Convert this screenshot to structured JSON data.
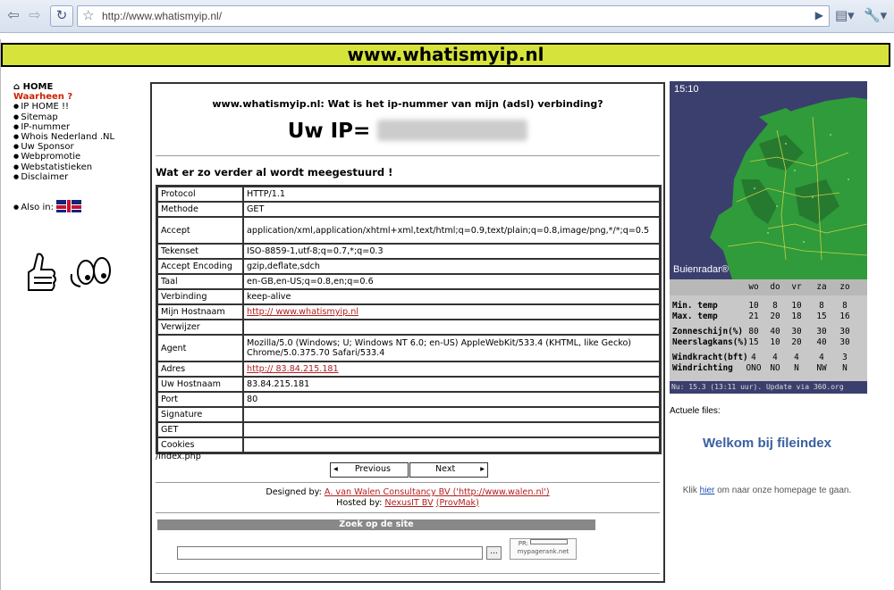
{
  "browser": {
    "url": "http://www.whatismyip.nl/"
  },
  "site": {
    "title": "www.whatismyip.nl"
  },
  "nav": {
    "home": "HOME",
    "where": "Waarheen ?",
    "items": [
      "IP HOME !!",
      "Sitemap",
      "IP-nummer",
      "Whois Nederland .NL",
      "Uw Sponsor",
      "Webpromotie",
      "Webstatistieken",
      "Disclaimer"
    ],
    "also_in": "Also in:"
  },
  "main": {
    "question": "www.whatismyip.nl: Wat is het ip-nummer van mijn (adsl) verbinding?",
    "ip_label": "Uw IP=",
    "subheading": "Wat er zo verder al wordt meegestuurd !",
    "rows": [
      {
        "key": "Protocol",
        "value": "HTTP/1.1"
      },
      {
        "key": "Methode",
        "value": "GET"
      },
      {
        "key": "Accept",
        "value": "application/xml,application/xhtml+xml,text/html;q=0.9,text/plain;q=0.8,image/png,*/*;q=0.5"
      },
      {
        "key": "Tekenset",
        "value": "ISO-8859-1,utf-8;q=0.7,*;q=0.3"
      },
      {
        "key": "Accept Encoding",
        "value": "gzip,deflate,sdch"
      },
      {
        "key": "Taal",
        "value": "en-GB,en-US;q=0.8,en;q=0.6"
      },
      {
        "key": "Verbinding",
        "value": "keep-alive"
      },
      {
        "key": "Mijn Hostnaam",
        "value": "http:// www.whatismyip.nl",
        "link": true
      },
      {
        "key": "Verwijzer",
        "value": ""
      },
      {
        "key": "Agent",
        "value": "Mozilla/5.0 (Windows; U; Windows NT 6.0; en-US) AppleWebKit/533.4 (KHTML, like Gecko) Chrome/5.0.375.70 Safari/533.4",
        "tall": true
      },
      {
        "key": "Adres",
        "value": "http:// 83.84.215.181",
        "link": true
      },
      {
        "key": "Uw Hostnaam",
        "value": "83.84.215.181"
      },
      {
        "key": "Port",
        "value": "80"
      },
      {
        "key": "Signature",
        "value": ""
      },
      {
        "key": "GET",
        "value": ""
      },
      {
        "key": "Cookies",
        "value": ""
      }
    ],
    "path": "/index.php",
    "prev_label": "Previous",
    "next_label": "Next",
    "designed_by": "Designed by:",
    "designer": "A. van Walen Consultancy BV ('http://www.walen.nl')",
    "hosted_by": "Hosted by:",
    "host1": "NexusIT BV",
    "host2": "(ProvMak)",
    "search_title": "Zoek op de site",
    "search_btn": "...",
    "pagerank_label": "PR:",
    "pagerank_site": "mypagerank.net"
  },
  "weather": {
    "time": "15:10",
    "brand": "Buienradar®",
    "days": [
      "wo",
      "do",
      "vr",
      "za",
      "zo"
    ],
    "rows": [
      {
        "label": "Min. temp",
        "values": [
          "10",
          "8",
          "10",
          "8",
          "8"
        ]
      },
      {
        "label": "Max. temp",
        "values": [
          "21",
          "20",
          "18",
          "15",
          "16"
        ]
      },
      {
        "label": "Zonneschijn(%)",
        "values": [
          "80",
          "40",
          "30",
          "30",
          "30"
        ]
      },
      {
        "label": "Neerslagkans(%)",
        "values": [
          "15",
          "10",
          "20",
          "40",
          "30"
        ]
      },
      {
        "label": "Windkracht(bft)",
        "values": [
          "4",
          "4",
          "4",
          "4",
          "3"
        ]
      },
      {
        "label": "Windrichting",
        "values": [
          "ONO",
          "NO",
          "N",
          "NW",
          "N"
        ]
      }
    ],
    "footer": "Nu: 15.3 (13:11 uur). Update via 360.org",
    "colors": {
      "land": "#2f9b3a",
      "sea": "#3b3f6e"
    }
  },
  "right": {
    "files": "Actuele files:",
    "welkom": "Welkom bij fileindex",
    "klik_pre": "Klik",
    "klik_link": "hier",
    "klik_post": "om naar onze homepage te gaan."
  }
}
